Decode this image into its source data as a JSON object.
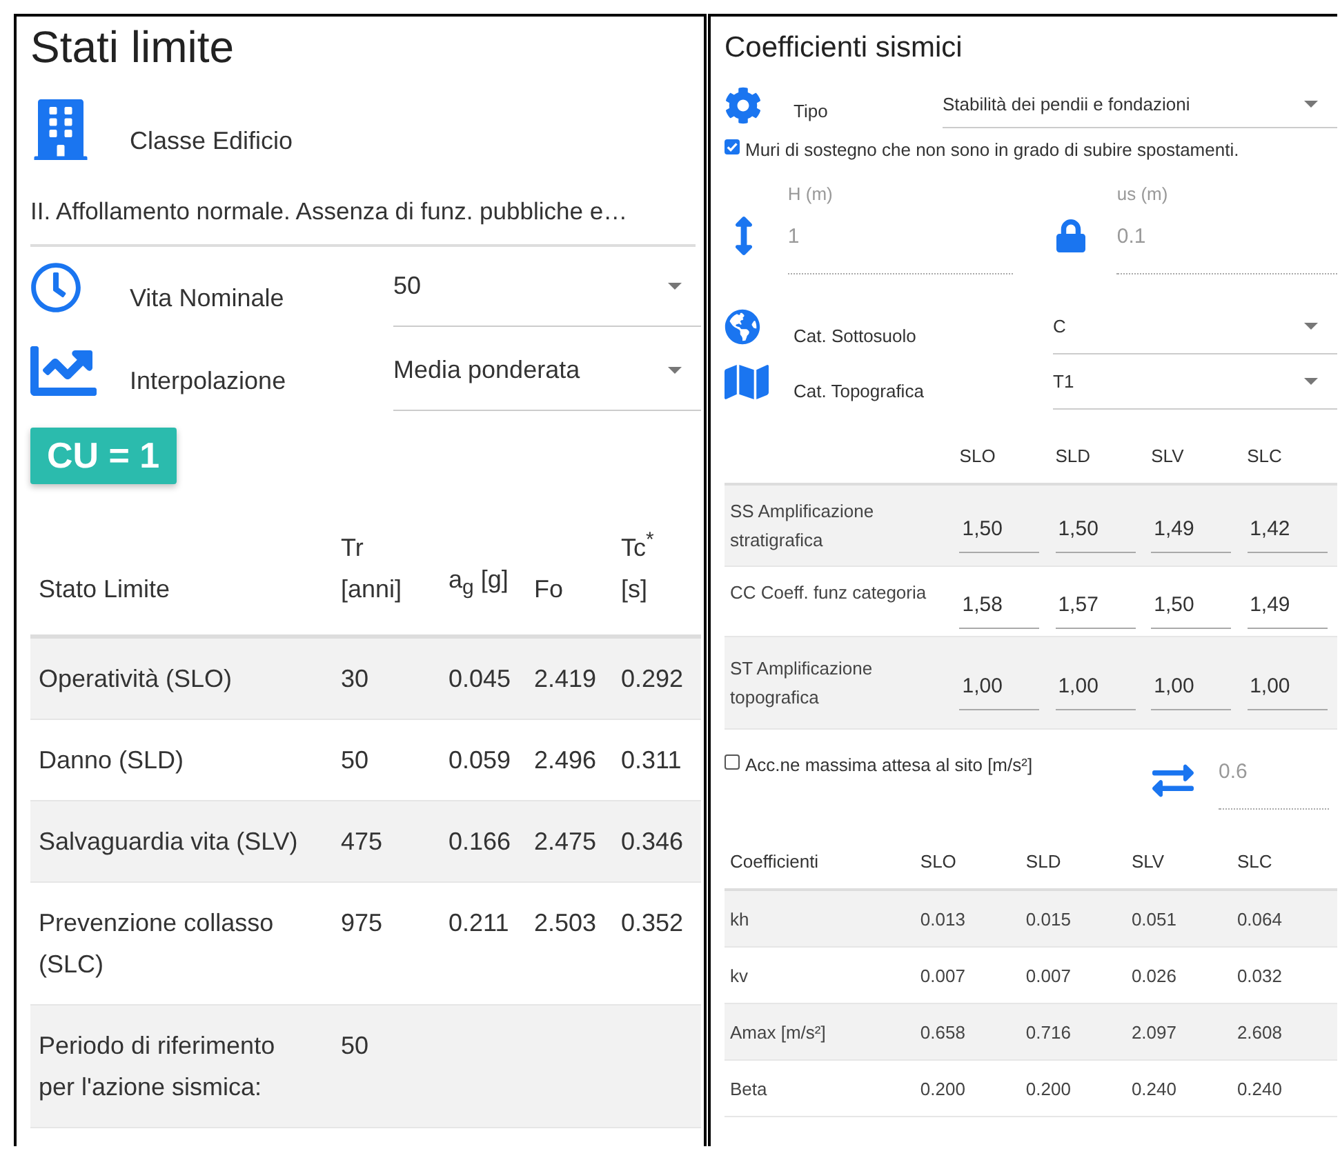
{
  "limit_states": {
    "title": "Stati limite",
    "building_class": {
      "label": "Classe Edificio",
      "value": "II. Affollamento normale. Assenza di funz. pubbliche e…"
    },
    "nominal_life": {
      "label": "Vita Nominale",
      "value": "50"
    },
    "interpolation": {
      "label": "Interpolazione",
      "value": "Media ponderata"
    },
    "cu_badge": "CU = 1",
    "table": {
      "columns": [
        "Stato Limite",
        "Tr [anni]",
        "a$_{g}$ [g]",
        "Fo",
        "Tc$^{*}$ [s]"
      ],
      "rows": [
        {
          "cells": [
            "Operatività (SLO)",
            "30",
            "0.045",
            "2.419",
            "0.292"
          ]
        },
        {
          "cells": [
            "Danno (SLD)",
            "50",
            "0.059",
            "2.496",
            "0.311"
          ]
        },
        {
          "cells": [
            "Salvaguardia vita (SLV)",
            "475",
            "0.166",
            "2.475",
            "0.346"
          ]
        },
        {
          "cells": [
            "Prevenzione collasso (SLC)",
            "975",
            "0.211",
            "2.503",
            "0.352"
          ]
        },
        {
          "cells": [
            "Periodo di riferimento per l'azione sismica:",
            "50"
          ]
        }
      ]
    }
  },
  "seismic": {
    "title": "Coefficienti sismici",
    "type": {
      "label": "Tipo",
      "value": "Stabilità dei pendii e fondazioni"
    },
    "retaining_walls": {
      "label": "Muri di sostegno che non sono in grado di subire spostamenti.",
      "checked": true
    },
    "fields": [
      {
        "label": "H (m)",
        "value": "1",
        "disabled": true
      },
      {
        "label": "us (m)",
        "value": "0.1",
        "disabled": true
      }
    ],
    "subsoil": {
      "label": "Cat. Sottosuolo",
      "value": "C"
    },
    "topography": {
      "label": "Cat. Topografica",
      "value": "T1"
    },
    "amplification": {
      "columns": [
        "SLO",
        "SLD",
        "SLV",
        "SLC"
      ],
      "rows": [
        {
          "label": "SS Amplificazione stratigrafica",
          "values": [
            "1,50",
            "1,50",
            "1,49",
            "1,42"
          ]
        },
        {
          "label": "CC Coeff. funz categoria",
          "values": [
            "1,58",
            "1,57",
            "1,50",
            "1,49"
          ]
        },
        {
          "label": "ST Amplificazione topografica",
          "values": [
            "1,00",
            "1,00",
            "1,00",
            "1,00"
          ]
        }
      ]
    },
    "max_acc": {
      "label": "Acc.ne massima attesa al sito [m/s²]",
      "checked": false,
      "value": "0.6",
      "disabled": true
    },
    "coefficients": {
      "columns": [
        "Coefficienti",
        "SLO",
        "SLD",
        "SLV",
        "SLC"
      ],
      "rows": [
        {
          "cells": [
            "kh",
            "0.013",
            "0.015",
            "0.051",
            "0.064"
          ]
        },
        {
          "cells": [
            "kv",
            "0.007",
            "0.007",
            "0.026",
            "0.032"
          ]
        },
        {
          "cells": [
            "Amax [m/s²]",
            "0.658",
            "0.716",
            "2.097",
            "2.608"
          ]
        },
        {
          "cells": [
            "Beta",
            "0.200",
            "0.200",
            "0.240",
            "0.240"
          ]
        }
      ]
    }
  }
}
